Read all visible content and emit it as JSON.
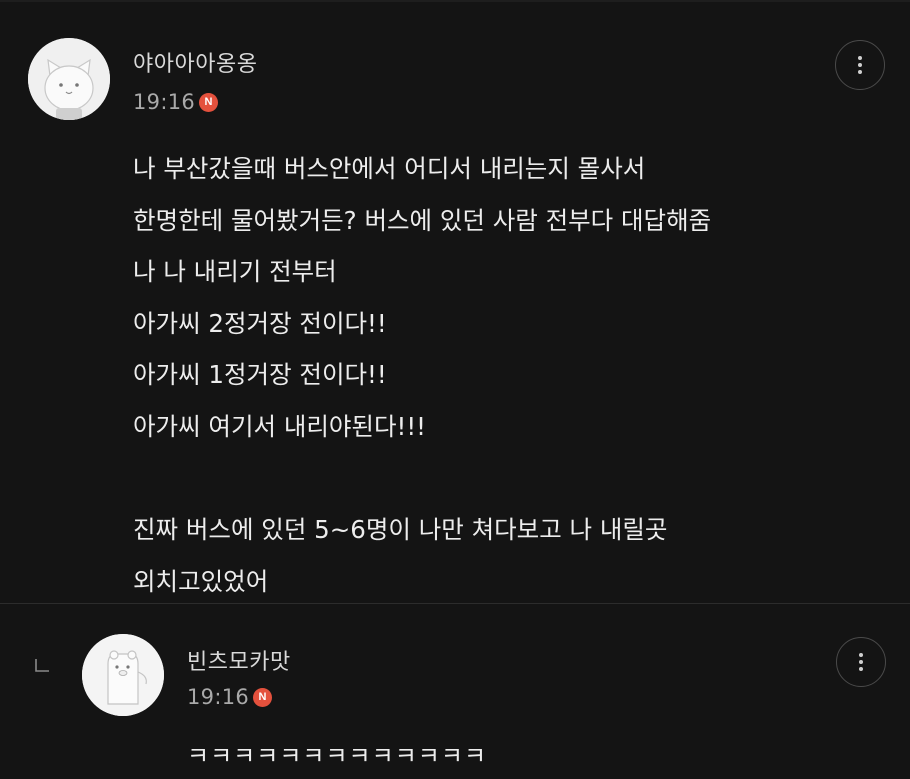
{
  "comments": [
    {
      "nickname": "야아아아옹옹",
      "time": "19:16",
      "badge": "N",
      "lines": [
        "나 부산갔을때 버스안에서 어디서 내리는지 몰사서",
        "한명한테 물어봤거든? 버스에 있던 사람 전부다 대답해줌",
        "나 나 내리기 전부터",
        "아가씨 2정거장 전이다!!",
        "아가씨 1정거장 전이다!!",
        "아가씨 여기서 내리야된다!!!",
        "",
        "진짜 버스에 있던 5~6명이 나만 쳐다보고 나 내릴곳",
        "외치고있었어"
      ]
    },
    {
      "nickname": "빈츠모카맛",
      "time": "19:16",
      "badge": "N",
      "text": "ㅋㅋㅋㅋㅋㅋㅋㅋㅋㅋㅋㅋㅋ"
    }
  ],
  "colors": {
    "background": "#141414",
    "badge": "#e4513d",
    "text": "#ededed",
    "meta": "#a9a9a9"
  },
  "icons": {
    "more": "more-vertical-icon",
    "reply": "reply-arrow-icon",
    "new": "new-badge-icon"
  }
}
